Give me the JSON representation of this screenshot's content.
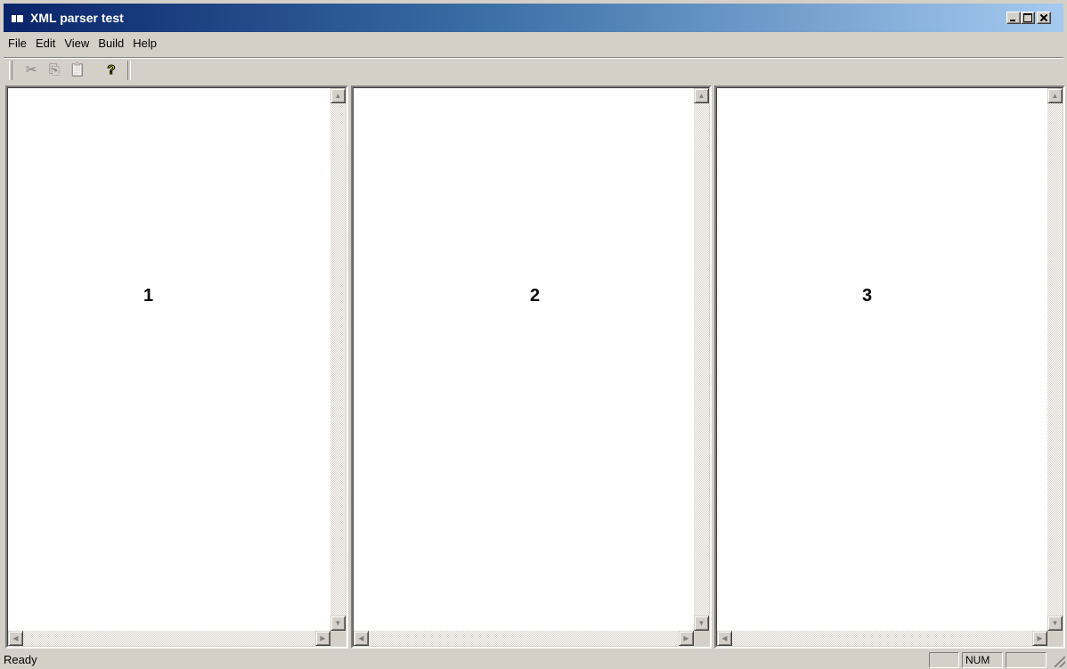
{
  "window": {
    "title": "XML parser test",
    "colors": {
      "titlebar_start": "#0a246a",
      "titlebar_end": "#a6caf0",
      "face": "#d4d0c8"
    }
  },
  "menubar": {
    "items": [
      "File",
      "Edit",
      "View",
      "Build",
      "Help"
    ]
  },
  "toolbar": {
    "buttons": [
      {
        "icon": "cut-icon",
        "glyph": "✂"
      },
      {
        "icon": "copy-icon",
        "glyph": "⎘"
      },
      {
        "icon": "paste-icon",
        "glyph": "📋"
      },
      {
        "icon": "help-icon",
        "glyph": "?"
      }
    ]
  },
  "panes": [
    {
      "label": "1"
    },
    {
      "label": "2"
    },
    {
      "label": "3"
    }
  ],
  "statusbar": {
    "text": "Ready",
    "indicators": [
      "",
      "NUM",
      ""
    ]
  }
}
